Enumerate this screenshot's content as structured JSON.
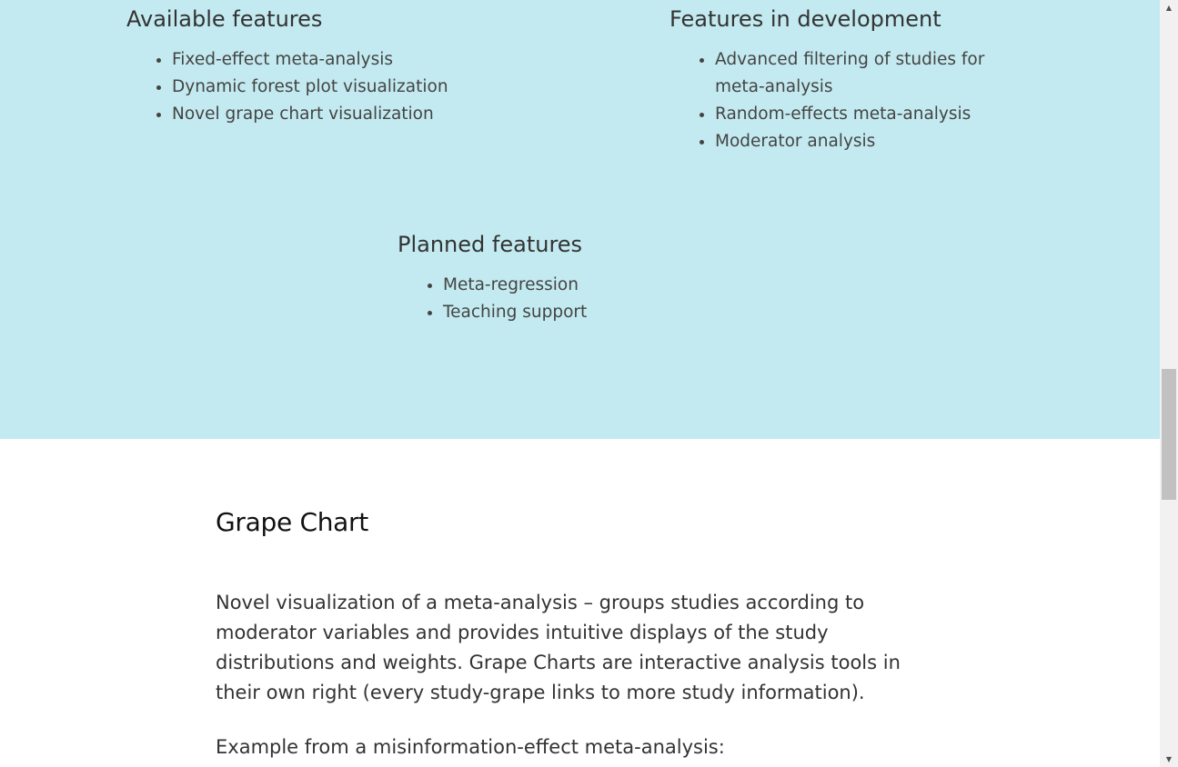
{
  "features": {
    "available": {
      "title": "Available features",
      "items": [
        "Fixed-effect meta-analysis",
        "Dynamic forest plot visualization",
        "Novel grape chart visualization"
      ]
    },
    "in_development": {
      "title": "Features in development",
      "items": [
        "Advanced filtering of studies for meta-analysis",
        "Random-effects meta-analysis",
        "Moderator analysis"
      ]
    },
    "planned": {
      "title": "Planned features",
      "items": [
        "Meta-regression",
        "Teaching support"
      ]
    },
    "band_color": "#c3eaf0"
  },
  "grape_chart": {
    "heading": "Grape Chart",
    "description": "Novel visualization of a meta-analysis – groups studies according to moderator variables and provides intuitive displays of the study distributions and weights. Grape Charts are interactive analysis tools in their own right (every study-grape links to more study information).",
    "example_label": "Example from a misinformation-effect meta-analysis:"
  },
  "scrollbar": {
    "up_icon": "scroll-up-arrow-icon",
    "down_icon": "scroll-down-arrow-icon",
    "up_glyph": "▲",
    "down_glyph": "▼"
  }
}
